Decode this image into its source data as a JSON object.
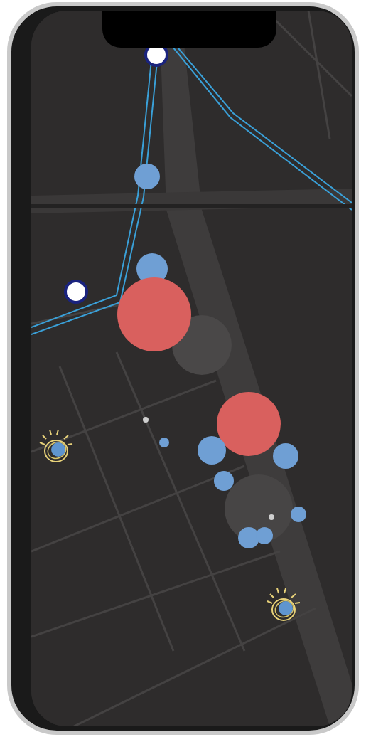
{
  "markers": [
    {
      "kind": "heat",
      "color": "#6f9fd4"
    },
    {
      "kind": "heat",
      "color": "#6f9fd4"
    },
    {
      "kind": "heat",
      "color": "#d9605e"
    },
    {
      "kind": "heat",
      "color": "#d9605e"
    },
    {
      "kind": "heat",
      "color": "#6f9fd4"
    },
    {
      "kind": "heat",
      "color": "#6f9fd4"
    },
    {
      "kind": "heat",
      "color": "#6f9fd4"
    },
    {
      "kind": "heat",
      "color": "#6f9fd4"
    },
    {
      "kind": "heat",
      "color": "#6f9fd4"
    },
    {
      "kind": "heat",
      "color": "#6f9fd4"
    },
    {
      "kind": "heat",
      "color": "#6f9fd4"
    },
    {
      "kind": "dot",
      "color": "#cfcfcf"
    },
    {
      "kind": "dot",
      "color": "#cfcfcf"
    },
    {
      "kind": "beacon",
      "color": "#5f95cf"
    },
    {
      "kind": "beacon",
      "color": "#5f95cf"
    }
  ]
}
